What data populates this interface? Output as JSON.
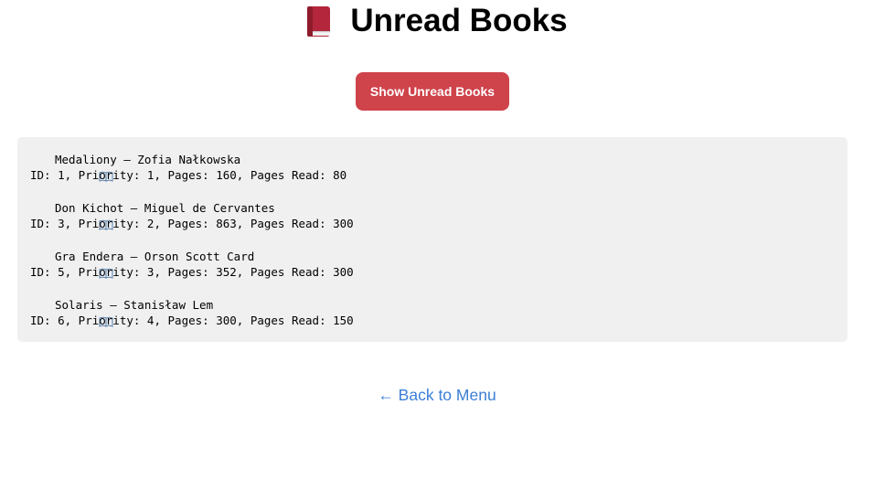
{
  "header": {
    "title": "Unread Books",
    "title_icon": "closed-book-icon"
  },
  "actions": {
    "show_button_label": "Show Unread Books",
    "accent_color": "#cf434b"
  },
  "books": [
    {
      "icon": "open-book-icon",
      "title_line": "Medaliony – Zofia Nałkowska",
      "detail_line": "ID: 1, Priority: 1, Pages: 160, Pages Read: 80"
    },
    {
      "icon": "open-book-icon",
      "title_line": "Don Kichot – Miguel de Cervantes",
      "detail_line": "ID: 3, Priority: 2, Pages: 863, Pages Read: 300"
    },
    {
      "icon": "open-book-icon",
      "title_line": "Gra Endera – Orson Scott Card",
      "detail_line": "ID: 5, Priority: 3, Pages: 352, Pages Read: 300"
    },
    {
      "icon": "open-book-icon",
      "title_line": "Solaris – Stanisław Lem",
      "detail_line": "ID: 6, Priority: 4, Pages: 300, Pages Read: 150"
    }
  ],
  "footer": {
    "back_link_label": "← Back to Menu",
    "link_color": "#3c7ed6"
  }
}
